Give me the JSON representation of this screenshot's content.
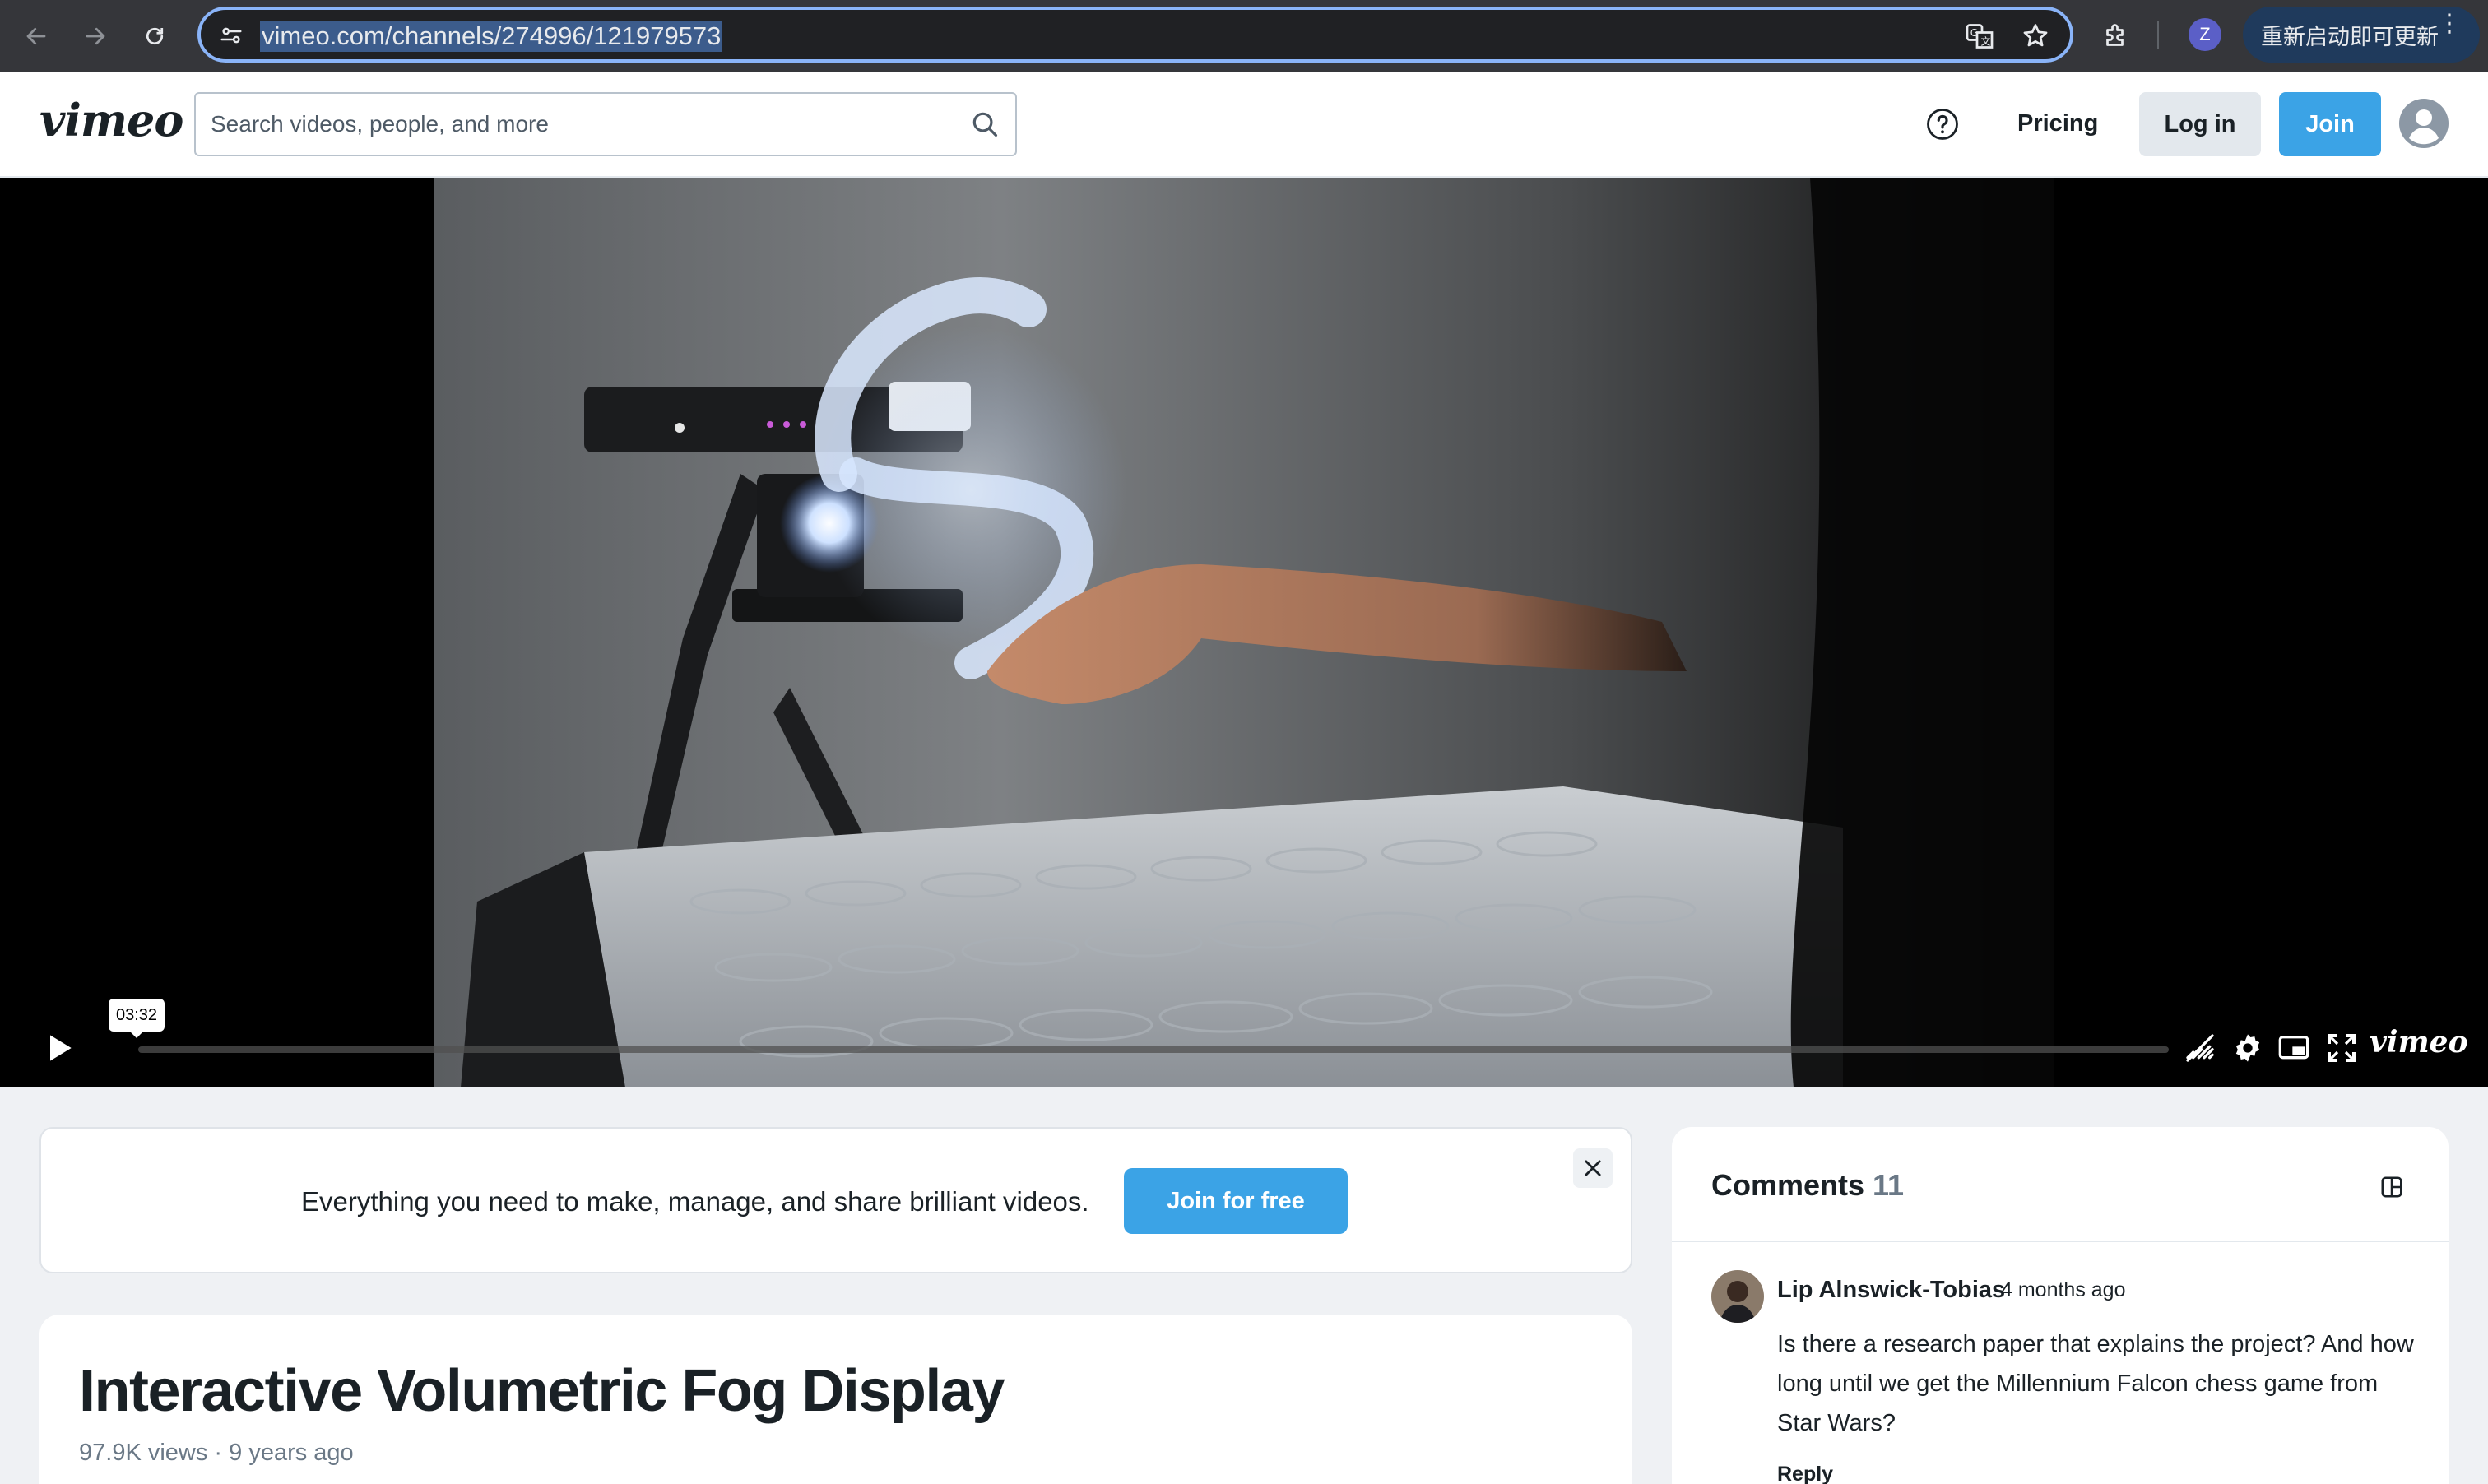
{
  "browser": {
    "url": "vimeo.com/channels/274996/121979573",
    "profile_initial": "Z",
    "update_label": "重新启动即可更新",
    "icons": [
      "back-arrow-icon",
      "forward-arrow-icon",
      "reload-icon",
      "site-settings-icon",
      "translate-icon",
      "bookmark-star-icon",
      "extensions-icon",
      "more-menu-icon"
    ]
  },
  "header": {
    "logo": "vimeo",
    "search_placeholder": "Search videos, people, and more",
    "pricing_label": "Pricing",
    "login_label": "Log in",
    "join_label": "Join"
  },
  "player": {
    "hover_time": "03:32",
    "progress": 0,
    "brand": "vimeo",
    "controls": [
      "play-icon",
      "audio-off-icon",
      "settings-gear-icon",
      "picture-in-picture-icon",
      "fullscreen-icon"
    ]
  },
  "banner": {
    "text": "Everything you need to make, manage, and share brilliant videos.",
    "cta": "Join for free"
  },
  "video": {
    "title": "Interactive Volumetric Fog Display",
    "meta": "97.9K views · 9 years ago"
  },
  "comments": {
    "title": "Comments",
    "count": "11",
    "items": [
      {
        "author": "Lip Alnswick-Tobias",
        "time": "4 months ago",
        "text": "Is there a research paper that explains the project? And how long until we get the Millennium Falcon chess game from Star Wars?",
        "reply_label": "Reply"
      }
    ]
  },
  "colors": {
    "brand_blue": "#3ba3e6",
    "chrome_bg": "#35363a",
    "focus_ring": "#8ab4f8"
  }
}
